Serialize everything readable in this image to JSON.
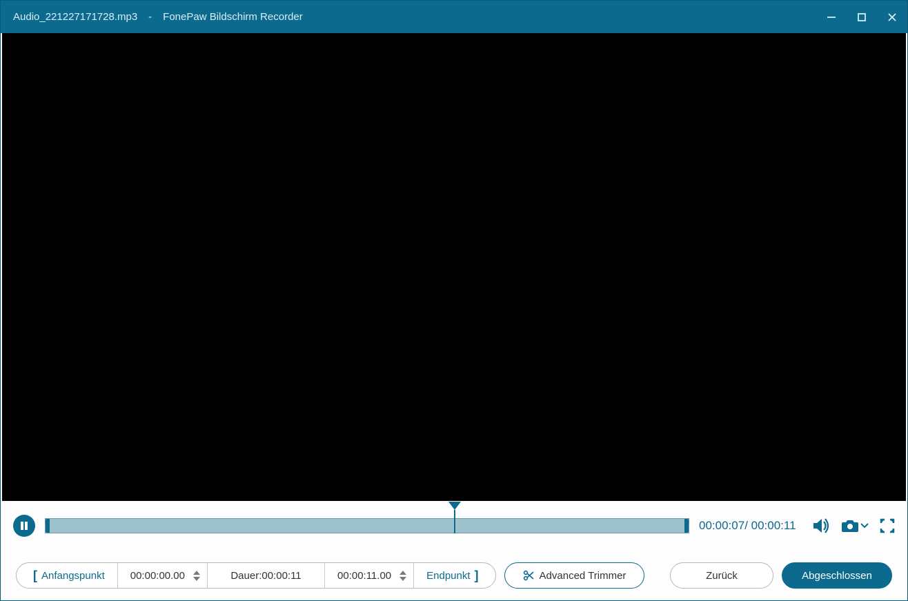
{
  "titlebar": {
    "filename": "Audio_221227171728.mp3",
    "separator": "-",
    "app_name": "FonePaw Bildschirm Recorder"
  },
  "playback": {
    "current_time": "00:00:07",
    "total_time": "00:00:11",
    "progress_percent": 63.6
  },
  "trim": {
    "start_label": "Anfangspunkt",
    "start_time": "00:00:00.00",
    "duration_label": "Dauer:",
    "duration_value": "00:00:11",
    "end_time": "00:00:11.00",
    "end_label": "Endpunkt",
    "advanced_label": "Advanced Trimmer"
  },
  "actions": {
    "back_label": "Zurück",
    "done_label": "Abgeschlossen"
  },
  "icons": {
    "pause": "pause-icon",
    "volume": "volume-icon",
    "camera": "camera-icon",
    "fullscreen": "fullscreen-icon",
    "scissors": "scissors-icon"
  }
}
